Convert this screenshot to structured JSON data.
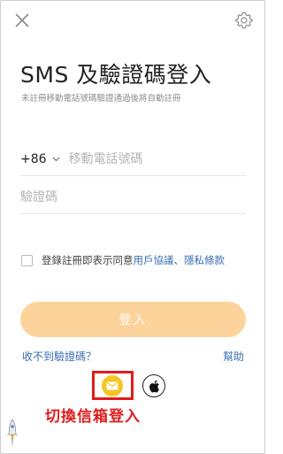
{
  "header": {
    "close_icon": "close-icon",
    "settings_icon": "gear-icon"
  },
  "title": "SMS 及驗證碼登入",
  "subtitle": "未註冊移動電話號碼驗證通過後將自動註冊",
  "phone": {
    "country_code": "+86",
    "placeholder": "移動電話號碼",
    "value": ""
  },
  "code": {
    "placeholder": "驗證碼",
    "value": ""
  },
  "agreement": {
    "checked": false,
    "text": "登錄註冊即表示同意",
    "user_agreement": "用戶協議",
    "separator": "、",
    "privacy_terms": "隱私條款"
  },
  "login_button": "登入",
  "no_code_link": "收不到驗證碼？",
  "help_link": "幫助",
  "alt_login": {
    "email_icon": "mail-icon",
    "apple_icon": "apple-icon"
  },
  "annotation": "切換信箱登入",
  "colors": {
    "accent_disabled": "#fcd39a",
    "link": "#3a6fb0",
    "annotation": "#e01c1c",
    "mail_button": "#f5c623"
  }
}
